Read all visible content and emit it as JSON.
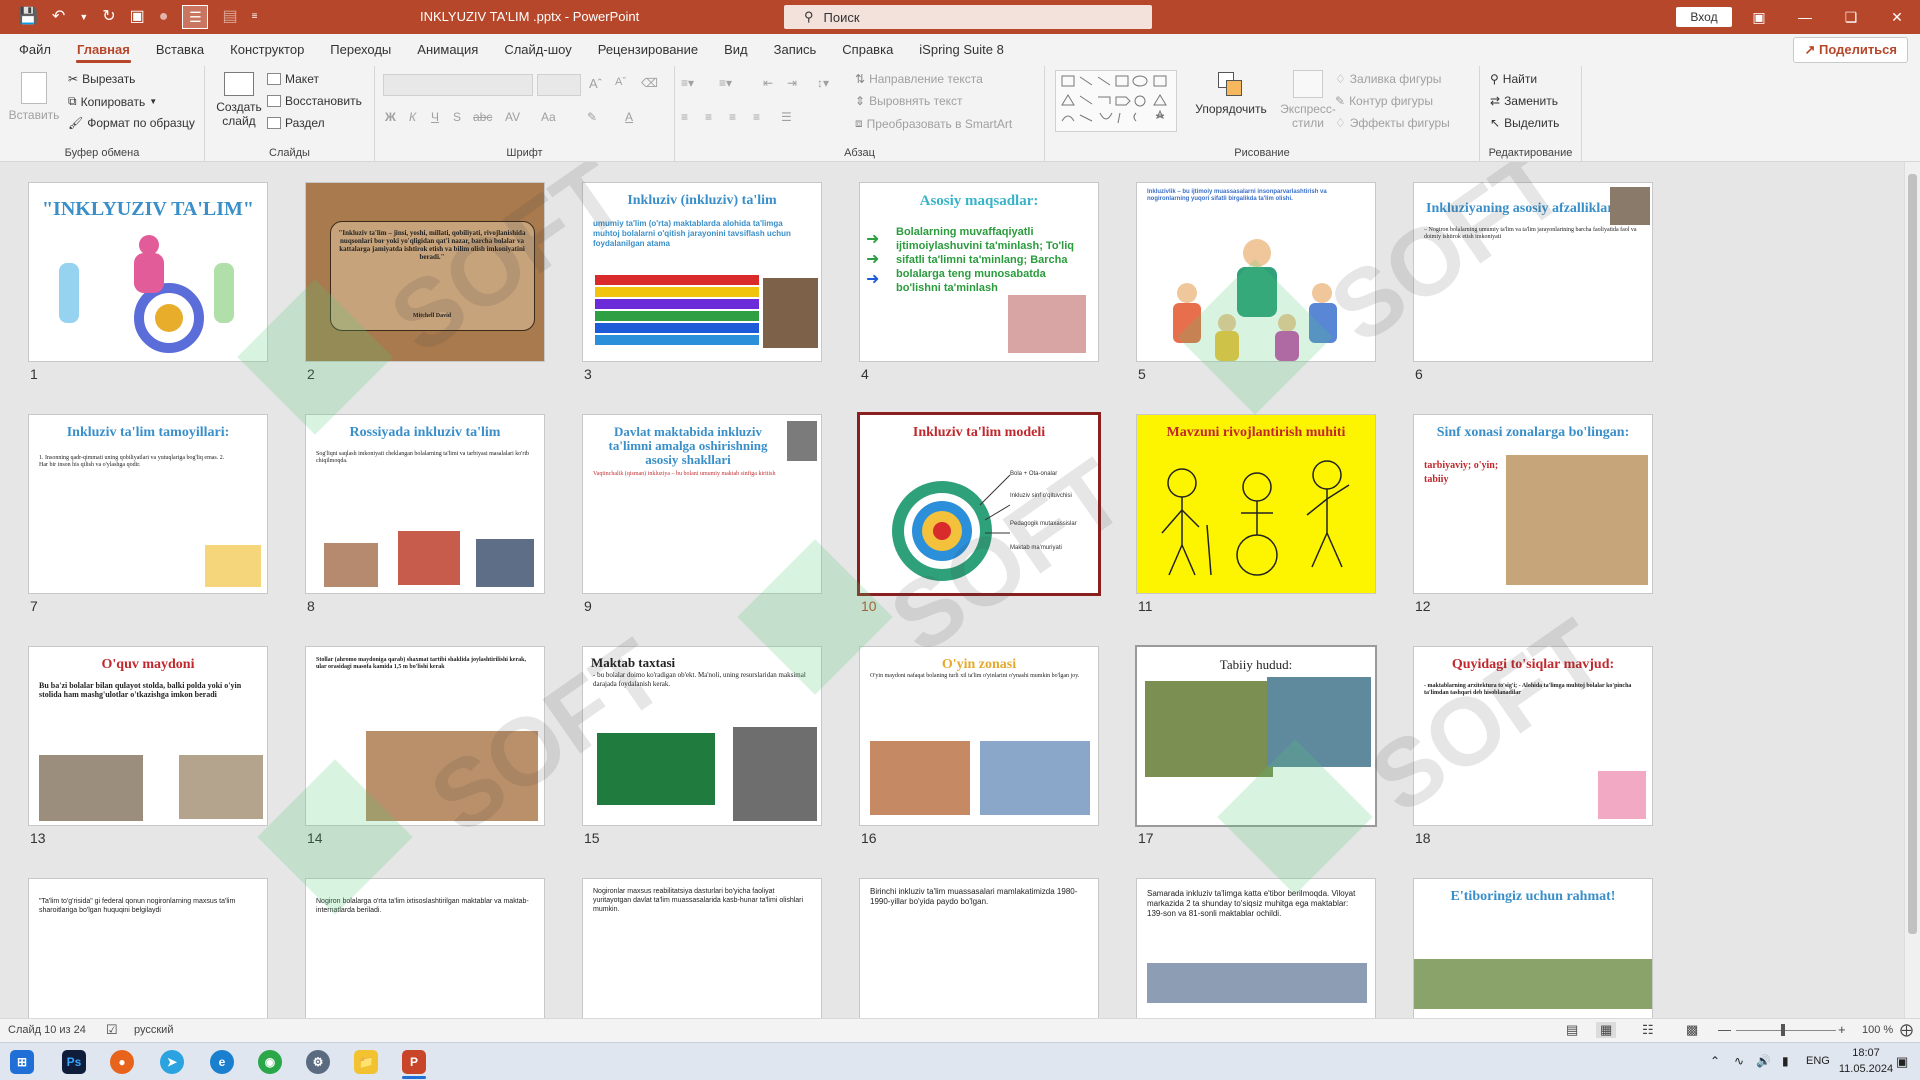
{
  "window": {
    "title": "INKLYUZIV TA'LIM .pptx  -  PowerPoint",
    "search_placeholder": "Поиск",
    "login": "Вход"
  },
  "tabs": [
    "Файл",
    "Главная",
    "Вставка",
    "Конструктор",
    "Переходы",
    "Анимация",
    "Слайд-шоу",
    "Рецензирование",
    "Вид",
    "Запись",
    "Справка",
    "iSpring Suite 8"
  ],
  "share": "Поделиться",
  "ribbon": {
    "clipboard": {
      "label": "Буфер обмена",
      "paste": "Вставить",
      "cut": "Вырезать",
      "copy": "Копировать",
      "format": "Формат по образцу"
    },
    "slides": {
      "label": "Слайды",
      "new": "Создать слайд",
      "layout": "Макет",
      "reset": "Восстановить",
      "section": "Раздел"
    },
    "font": {
      "label": "Шрифт",
      "bold": "Ж",
      "italic": "К",
      "underline": "Ч",
      "strike": "S",
      "aa": "Aa"
    },
    "paragraph": {
      "label": "Абзац",
      "direction": "Направление текста",
      "align": "Выровнять текст",
      "smartart": "Преобразовать в SmartArt"
    },
    "drawing": {
      "label": "Рисование",
      "arrange": "Упорядочить",
      "quick": "Экспресс-стили",
      "fill": "Заливка фигуры",
      "outline": "Контур фигуры",
      "effects": "Эффекты фигуры"
    },
    "editing": {
      "label": "Редактирование",
      "find": "Найти",
      "replace": "Заменить",
      "select": "Выделить"
    }
  },
  "slides": [
    {
      "n": "1",
      "title": "\"INKLYUZIV TA'LIM\"",
      "body": ""
    },
    {
      "n": "2",
      "title": "",
      "body": "\"Inkluziv ta'lim – jinsi, yoshi, millati, qobiliyati, rivojlanishida nuqsonlari bor yoki yo'qligidan qat'i nazar, barcha bolalar va kattalarga jamiyatda ishtirok etish va bilim olish imkoniyatini beradi.\"",
      "author": "Mitchell David"
    },
    {
      "n": "3",
      "title": "Inkluziv (inkluziv) ta'lim",
      "body": "umumiy ta'lim (o'rta) maktablarda alohida ta'limga muhtoj bolalarni o'qitish jarayonini tavsiflash uchun foydalanilgan atama"
    },
    {
      "n": "4",
      "title": "Asosiy maqsadlar:",
      "body": "Bolalarning muvaffaqiyatli ijtimoiylashuvini ta'minlash; To'liq sifatli ta'limni ta'minlang; Barcha bolalarga teng munosabatda bo'lishni ta'minlash"
    },
    {
      "n": "5",
      "title": "",
      "body": "Inkluzivlik – bu ijtimoiy muassasalarni insonparvarlashtirish va nogironlarning yuqori sifatli birgalikda ta'lim olishi."
    },
    {
      "n": "6",
      "title": "Inkluziyaning asosiy afzalliklari",
      "body": "– Nogiron bolalarning umumiy ta'lim va ta'lim jarayonlarining barcha faoliyatida faol va doimiy ishtirok etish imkoniyati"
    },
    {
      "n": "7",
      "title": "Inkluziv ta'lim tamoyillari:",
      "body": "1. Insonning qadr-qimmati uning qobiliyatlari va yutuqlariga bog'liq emas. 2. Har bir inson his qilish va o'ylashga qodir."
    },
    {
      "n": "8",
      "title": "Rossiyada inkluziv ta'lim",
      "body": "Sog'liqni saqlash imkoniyati cheklangan bolalarning ta'limi va tarbiyasi masalalari ko'rib chiqilmoqda."
    },
    {
      "n": "9",
      "title": "Davlat maktabida inkluziv ta'limni amalga oshirishning asosiy shakllari",
      "body": "Vaqtinchalik (qisman) inkluziya – bu bolani umumiy maktab sinfiga kiritish"
    },
    {
      "n": "10",
      "title": "Inkluziv ta'lim modeli",
      "body": ""
    },
    {
      "n": "11",
      "title": "Mavzuni rivojlantirish muhiti",
      "body": ""
    },
    {
      "n": "12",
      "title": "Sinf xonasi zonalarga bo'lingan:",
      "body": "tarbiyaviy; o'yin; tabiiy"
    },
    {
      "n": "13",
      "title": "O'quv maydoni",
      "body": "Bu ba'zi bolalar bilan qulayot stolda, balki polda yoki o'yin stolida ham mashg'ulotlar o'tkazishga imkon beradi"
    },
    {
      "n": "14",
      "title": "",
      "body": "Stollar (ahromo maydoniga qarab) shaxmat tartibi shaklida joylashtirilishi kerak, ular orasidagi masofa kamida 1,5 m bo'lishi kerak"
    },
    {
      "n": "15",
      "title": "Maktab taxtasi",
      "body": "- bu bolalar doimo ko'radigan ob'ekt. Ma'noli, uning resurslaridan maksimal darajada foydalanish kerak."
    },
    {
      "n": "16",
      "title": "O'yin zonasi",
      "body": "O'yin maydoni nafaqat bolaning turli xil ta'lim o'yinlarini o'ynashi mumkin bo'lgan joy."
    },
    {
      "n": "17",
      "title": "Tabiiy hudud:",
      "body": ""
    },
    {
      "n": "18",
      "title": "Quyidagi to'siqlar mavjud:",
      "body": "- maktablarning arxitektura to'sig'i; - Alohida ta'limga muhtoj bolalar ko'pincha ta'limdan tashqari deb hisoblanadilar"
    },
    {
      "n": "19",
      "title": "",
      "body": "\"Ta'lim to'g'risida\" gi federal qonun nogironlarning maxsus ta'lim sharoitlariga bo'lgan huquqini belgilaydi"
    },
    {
      "n": "20",
      "title": "",
      "body": "Nogiron bolalarga o'rta ta'lim ixtisoslashtirilgan maktablar va maktab-internatlarda beriladi."
    },
    {
      "n": "21",
      "title": "",
      "body": "Nogironlar maxsus reabilitatsiya dasturlari bo'yicha faoliyat yuritayotgan davlat ta'lim muassasalarida kasb-hunar ta'limi olishlari mumkin."
    },
    {
      "n": "22",
      "title": "",
      "body": "Birinchi inkluziv ta'lim muassasalari mamlakatimizda 1980-1990-yillar bo'yida paydo bo'lgan."
    },
    {
      "n": "23",
      "title": "",
      "body": "Samarada inkluziv ta'limga katta e'tibor berilmoqda. Viloyat markazida 2 ta shunday to'siqsiz muhitga ega maktablar: 139-son va 81-sonli maktablar ochildi."
    },
    {
      "n": "24",
      "title": "E'tiboringiz uchun rahmat!",
      "body": ""
    }
  ],
  "status": {
    "slide": "Слайд 10 из 24",
    "lang": "русский",
    "zoom": "100 %"
  },
  "taskbar": {
    "lang": "ENG",
    "time": "18:07",
    "date": "11.05.2024"
  },
  "watermark": "SOFT"
}
